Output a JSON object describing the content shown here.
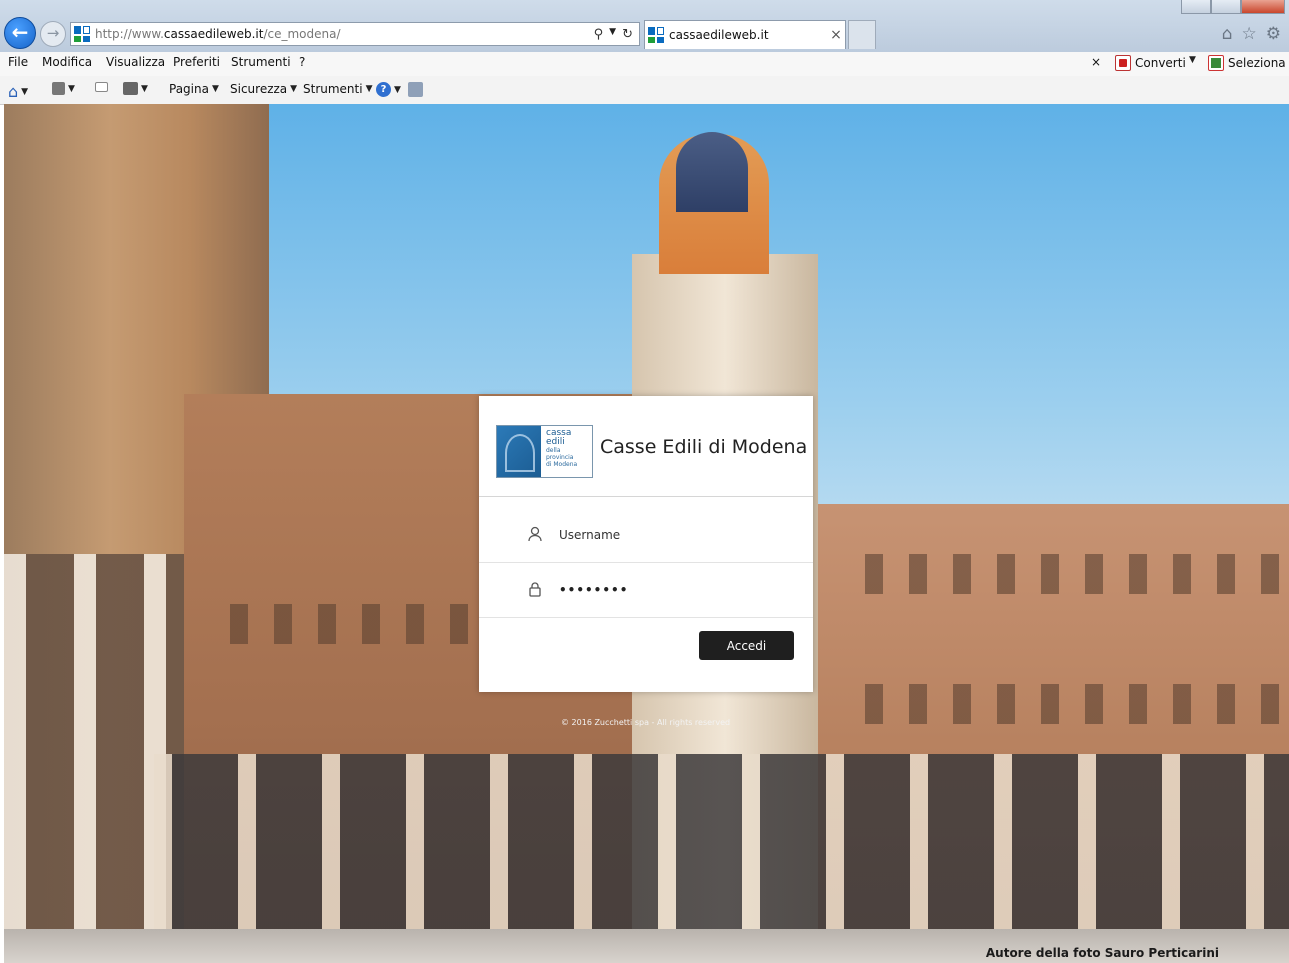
{
  "browser": {
    "url_prefix": "http://www.",
    "url_domain": "cassaedileweb.it",
    "url_path": "/ce_modena/",
    "tab_title": "cassaedileweb.it",
    "menu": [
      "File",
      "Modifica",
      "Visualizza",
      "Preferiti",
      "Strumenti",
      "?"
    ],
    "menu_right": {
      "converti": "Converti",
      "seleziona": "Seleziona"
    },
    "toolbar": {
      "pagina": "Pagina",
      "sicurezza": "Sicurezza",
      "strumenti": "Strumenti"
    }
  },
  "login": {
    "title": "Casse Edili di Modena",
    "logo_text": {
      "line1": "cassa",
      "line2": "edili",
      "line3": "della",
      "line4": "provincia",
      "line5": "di Modena"
    },
    "username_placeholder": "Username",
    "password_value": "••••••••",
    "submit_label": "Accedi"
  },
  "footer": {
    "copyright": "© 2016 Zucchetti spa - All rights reserved",
    "photo_credit": "Autore della foto Sauro Perticarini"
  },
  "colors": {
    "accent_blue": "#1764c9",
    "button_dark": "#1f1f1f"
  }
}
